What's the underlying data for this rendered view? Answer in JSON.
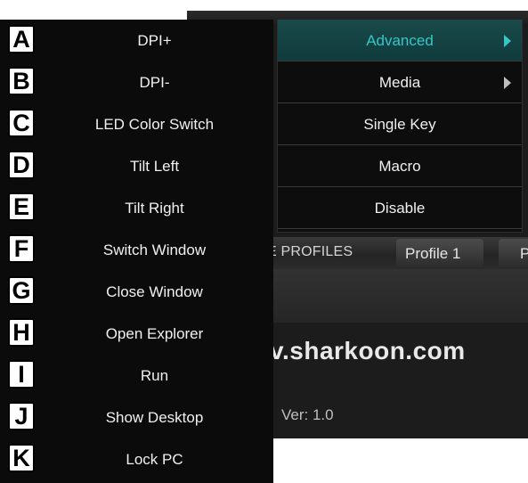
{
  "background_app": {
    "profiles_label": "E PROFILES",
    "profile_tab": "Profile 1",
    "profile_tab_partial": "P",
    "website": "v.sharkoon.com",
    "version": "Ver:  1.0"
  },
  "left_menu": {
    "items": [
      {
        "letter": "A",
        "label": "DPI+"
      },
      {
        "letter": "B",
        "label": "DPI-"
      },
      {
        "letter": "C",
        "label": "LED Color Switch"
      },
      {
        "letter": "D",
        "label": "Tilt Left"
      },
      {
        "letter": "E",
        "label": "Tilt Right"
      },
      {
        "letter": "F",
        "label": "Switch Window"
      },
      {
        "letter": "G",
        "label": "Close Window"
      },
      {
        "letter": "H",
        "label": "Open Explorer"
      },
      {
        "letter": "I",
        "label": "Run"
      },
      {
        "letter": "J",
        "label": "Show Desktop"
      },
      {
        "letter": "K",
        "label": "Lock PC"
      }
    ]
  },
  "right_menu": {
    "items": [
      {
        "label": "Advanced",
        "active": true,
        "submenu": true
      },
      {
        "label": "Media",
        "active": false,
        "submenu": true
      },
      {
        "label": "Single Key",
        "active": false,
        "submenu": false
      },
      {
        "label": "Macro",
        "active": false,
        "submenu": false
      },
      {
        "label": "Disable",
        "active": false,
        "submenu": false
      }
    ]
  },
  "colors": {
    "accent": "#36c6c6",
    "menu_bg": "#0b0b0b",
    "active_bg": "#123f40"
  }
}
